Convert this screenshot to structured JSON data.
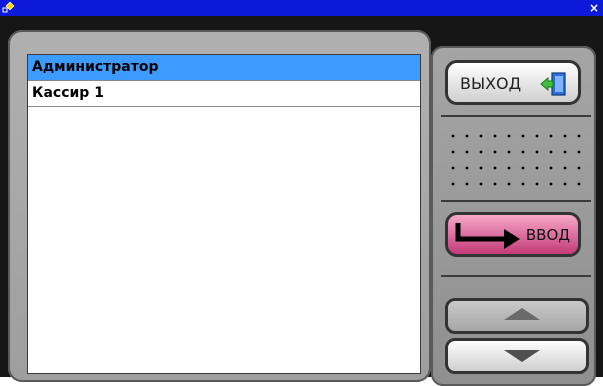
{
  "window": {
    "title": "",
    "close_symbol": "×",
    "app_icon": "app-icon"
  },
  "list": {
    "items": [
      {
        "label": "Администратор",
        "selected": true
      },
      {
        "label": "Кассир 1",
        "selected": false
      }
    ]
  },
  "buttons": {
    "exit_label": "ВЫХОД",
    "enter_label": "ВВОД",
    "up_icon": "arrow-up-icon",
    "down_icon": "arrow-down-icon"
  },
  "colors": {
    "titlebar": "#0a1ad8",
    "selection": "#3d9bff",
    "enter_button": "#c23a78",
    "frame": "#161616"
  }
}
